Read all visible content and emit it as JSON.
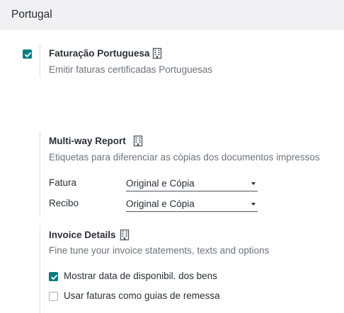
{
  "section": {
    "title": "Portugal"
  },
  "fatura_pt": {
    "checked": true,
    "title": "Faturação Portuguesa",
    "description": "Emitir faturas certificadas Portuguesas",
    "icon": "building-icon"
  },
  "multi_way": {
    "title": "Multi-way Report",
    "description": "Etiquetas para diferenciar as cópias dos documentos impressos",
    "icon": "building-icon",
    "fields": [
      {
        "label": "Fatura",
        "value": "Original e Cópia"
      },
      {
        "label": "Recibo",
        "value": "Original e Cópia"
      }
    ]
  },
  "invoice_details": {
    "title": "Invoice Details",
    "description": "Fine tune your invoice statements, texts and options",
    "icon": "building-icon",
    "options": [
      {
        "label": "Mostrar data de disponibil. dos bens",
        "checked": true
      },
      {
        "label": "Usar faturas como guias de remessa",
        "checked": false
      }
    ]
  },
  "colors": {
    "accent": "#017e84",
    "header_bg": "#f1f1f4",
    "muted_text": "#6c737b"
  }
}
